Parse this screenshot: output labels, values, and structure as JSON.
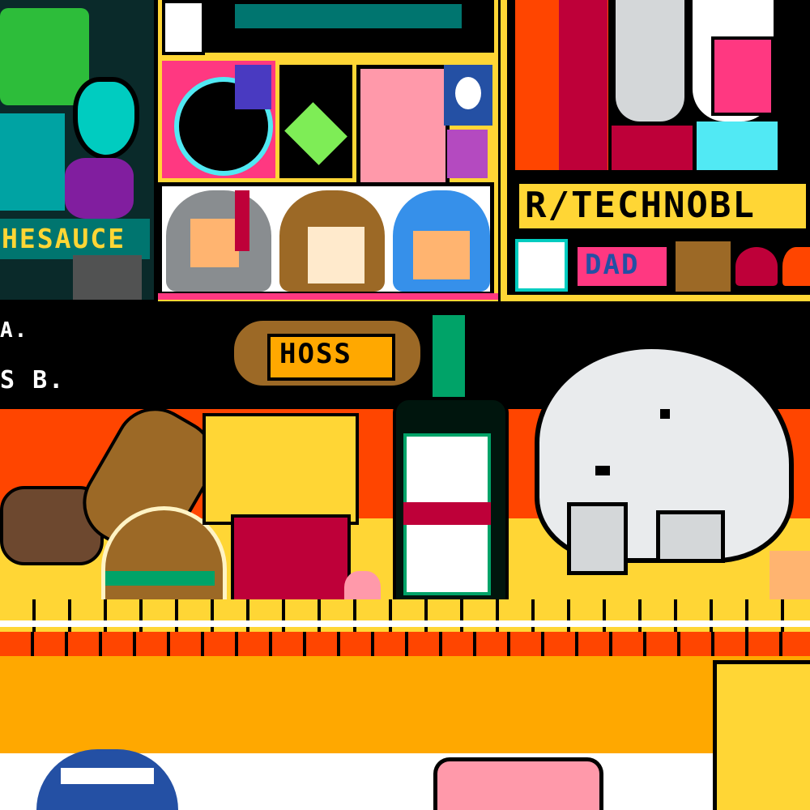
{
  "canvas": {
    "labels": {
      "sauce_banner": "HESAUCE",
      "technoblade_banner": "R/TECHNOBL",
      "dad_badge": "DAD",
      "hotdog_sign": "HOSS",
      "left_fragment_1": "A.",
      "left_fragment_2": "S B."
    }
  },
  "colors": {
    "orange": "#ff4500",
    "gold": "#ffd635",
    "amber": "#ffa800",
    "black": "#000000",
    "white": "#ffffff",
    "navy": "#2450a4",
    "pink": "#ff99aa",
    "green": "#00a368"
  }
}
